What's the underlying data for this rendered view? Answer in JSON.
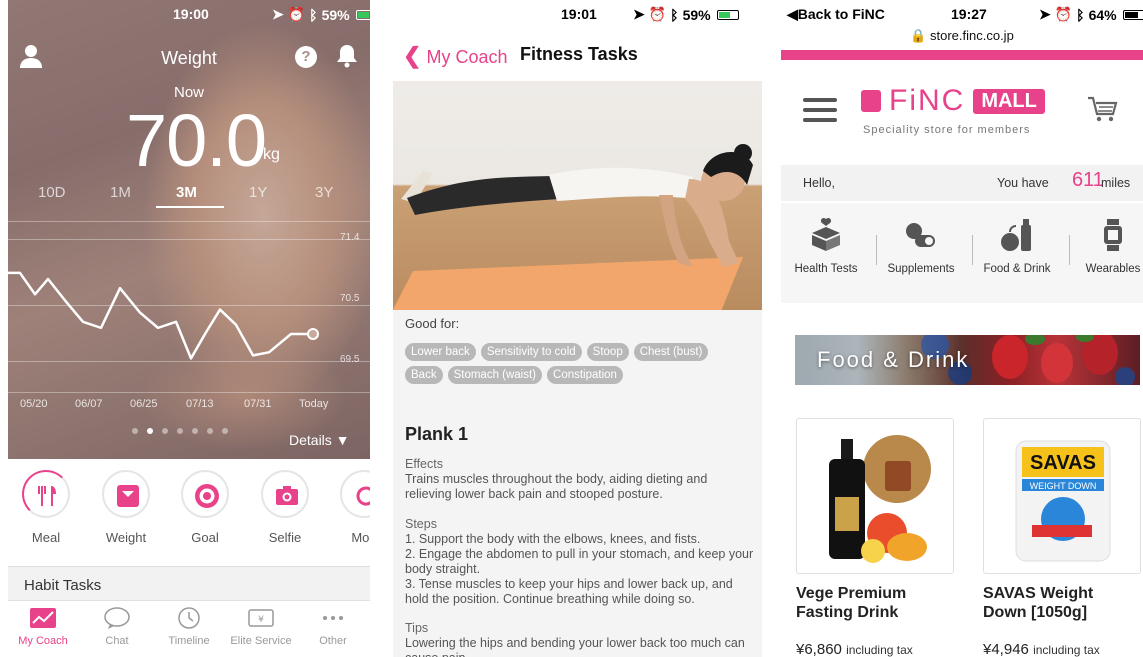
{
  "screen1": {
    "status": {
      "time": "19:00",
      "battery": "59%"
    },
    "title": "Weight",
    "now_label": "Now",
    "value": "70.0",
    "unit": "kg",
    "ranges": [
      "10D",
      "1M",
      "3M",
      "1Y",
      "3Y"
    ],
    "active_range": "3M",
    "details": "Details ▼",
    "categories": [
      "Meal",
      "Weight",
      "Goal",
      "Selfie",
      "Moo"
    ],
    "habit_tasks": "Habit Tasks",
    "tabs": [
      "My Coach",
      "Chat",
      "Timeline",
      "Elite Service",
      "Other"
    ],
    "page_indicator": {
      "count": 7,
      "active": 1
    }
  },
  "chart_data": {
    "type": "line",
    "x": [
      "05/20",
      "06/07",
      "06/25",
      "07/13",
      "07/31",
      "Today"
    ],
    "yticks": [
      "71.4",
      "70.5",
      "69.5"
    ],
    "ylim": [
      69.0,
      71.8
    ],
    "grid": true,
    "series": [
      {
        "values": [
          70.95,
          70.95,
          70.6,
          70.85,
          70.5,
          70.15,
          70.05,
          70.7,
          70.3,
          70.05,
          70.15,
          69.55,
          69.95,
          70.35,
          70.1,
          69.6,
          69.65,
          69.95,
          69.95
        ]
      }
    ],
    "x_positions": [
      0,
      12,
      27,
      40,
      57,
      75,
      93,
      112,
      132,
      150,
      168,
      183,
      197,
      212,
      228,
      245,
      261,
      283,
      305
    ]
  },
  "screen2": {
    "status": {
      "time": "19:01",
      "battery": "59%"
    },
    "back_label": "My Coach",
    "title": "Fitness Tasks",
    "good_for_label": "Good for:",
    "chips": [
      "Lower back",
      "Sensitivity to cold",
      "Stoop",
      "Chest (bust)",
      "Back",
      "Stomach (waist)",
      "Constipation"
    ],
    "exercise_title": "Plank 1",
    "effects_label": "Effects",
    "effects_text": "Trains muscles throughout the body, aiding dieting and relieving lower back pain and stooped posture.",
    "steps_label": "Steps",
    "steps": [
      "1. Support the body with the elbows, knees, and fists.",
      "2. Engage the abdomen to pull in your stomach, and keep your body straight.",
      "3. Tense muscles to keep your hips and lower back up, and hold the position. Continue breathing while doing so."
    ],
    "tips_label": "Tips",
    "tips_text": "Lowering the hips and bending your lower back too much can cause pain."
  },
  "screen3": {
    "status": {
      "back": "◀Back to FiNC",
      "time": "19:27",
      "battery": "64%"
    },
    "url": "store.finc.co.jp",
    "logo_word": "FiNC",
    "logo_badge": "MALL",
    "tagline": "Speciality store for members",
    "hello": "Hello,",
    "you_have": "You have",
    "miles": "611",
    "miles_unit": "miles",
    "tiles": [
      "Health Tests",
      "Supplements",
      "Food & Drink",
      "Wearables"
    ],
    "banner": "Food & Drink",
    "products": [
      {
        "name_line1": "Vege Premium",
        "name_line2": "Fasting Drink",
        "price": "¥6,860",
        "tax": "including tax"
      },
      {
        "name_line1": "SAVAS Weight",
        "name_line2": "Down [1050g]",
        "price": "¥4,946",
        "tax": "including tax"
      }
    ],
    "savas_brand": "SAVAS",
    "savas_sub": "WEIGHT DOWN"
  }
}
